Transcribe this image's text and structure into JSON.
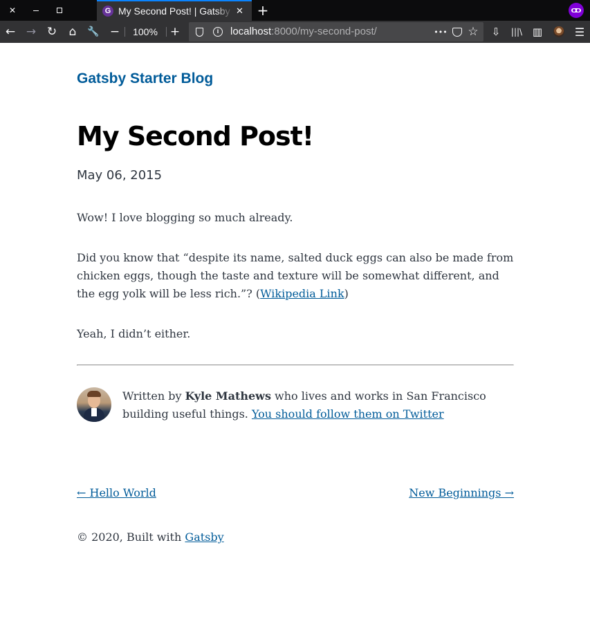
{
  "browser": {
    "tab": {
      "favicon_letter": "G",
      "title": "My Second Post! | Gatsby Starter Blog",
      "close": "✕"
    },
    "new_tab": "+",
    "window_controls": {
      "close": "✕"
    },
    "nav": {
      "back": "←",
      "forward": "→",
      "reload": "↻",
      "home": "⌂",
      "customize": "🔧",
      "zoom_out": "−",
      "zoom_level": "100%",
      "zoom_in": "+"
    },
    "url": {
      "host": "localhost",
      "rest": ":8000/my-second-post/"
    },
    "url_actions": {
      "more": "•••",
      "bookmark": "☆"
    },
    "toolbar_right": {
      "downloads": "⇩",
      "library": "|||\\",
      "sidebar": "▥",
      "menu": "☰"
    },
    "accent_color": "#0a84ff",
    "private_color": "#8000d7"
  },
  "site": {
    "title": "Gatsby Starter Blog",
    "link_color": "#005b99"
  },
  "post": {
    "title": "My Second Post!",
    "date": "May 06, 2015",
    "paragraph1": "Wow! I love blogging so much already.",
    "paragraph2_before": "Did you know that “despite its name, salted duck eggs can also be made from chicken eggs, though the taste and texture will be somewhat different, and the egg yolk will be less rich.”? (",
    "paragraph2_link": "Wikipedia Link",
    "paragraph2_after": ")",
    "paragraph3": "Yeah, I didn’t either."
  },
  "bio": {
    "prefix": "Written by ",
    "author": "Kyle Mathews",
    "middle": " who lives and works in San Francisco building useful things. ",
    "twitter_link": "You should follow them on Twitter"
  },
  "post_nav": {
    "prev": "← Hello World",
    "next": "New Beginnings →"
  },
  "footer": {
    "prefix": "© 2020, Built with ",
    "link": "Gatsby"
  }
}
